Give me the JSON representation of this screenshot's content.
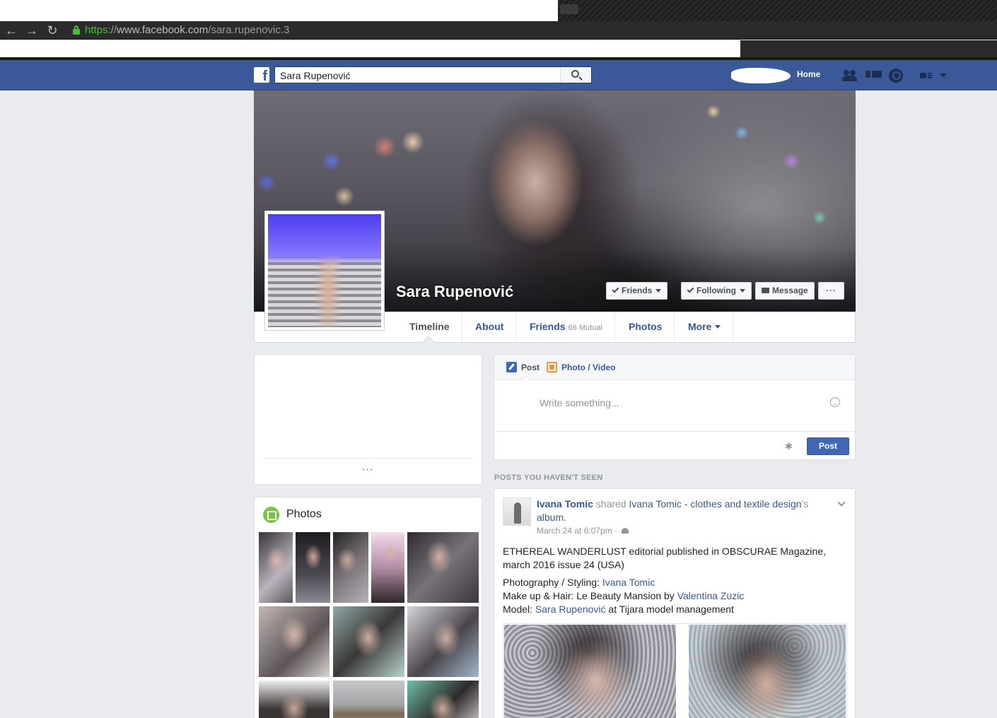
{
  "browser": {
    "url_scheme": "https",
    "url_sep": "://",
    "url_host": "www.facebook.com",
    "url_path": "/sara.rupenovic.3"
  },
  "topbar": {
    "logo": "f",
    "search_value": "Sara Rupenović",
    "home_label": "Home"
  },
  "profile": {
    "name": "Sara Rupenović",
    "buttons": {
      "friends": "Friends",
      "following": "Following",
      "message": "Message",
      "more": "···"
    },
    "tabs": {
      "timeline": "Timeline",
      "about": "About",
      "friends": "Friends",
      "friends_mutual": "66 Mutual",
      "photos": "Photos",
      "more": "More"
    }
  },
  "left": {
    "intro_more": "···",
    "photos_title": "Photos"
  },
  "composer": {
    "tab_post": "Post",
    "tab_photo_video": "Photo / Video",
    "placeholder": "Write something...",
    "post_button": "Post"
  },
  "feed": {
    "section_label": "POSTS YOU HAVEN'T SEEN",
    "post": {
      "actor": "Ivana Tomic",
      "verb": " shared ",
      "target": "Ivana Tomic - clothes and textile design",
      "suffix_1": "'s ",
      "album_word": "album",
      "period": ".",
      "timestamp": "March 24 at 6:07pm · ",
      "line1": "ETHEREAL WANDERLUST editorial published in OBSCURAE Magazine, march 2016 issue 24 (USA)",
      "credit1_label": "Photography / Styling: ",
      "credit1_link": "Ivana Tomic",
      "credit2_label": "Make up & Hair: Le Beauty Mansion by ",
      "credit2_link": "Valentina Zuzic",
      "credit3_label": "Model: ",
      "credit3_link": "Sara Rupenović",
      "credit3_suffix": " at Tijara model management"
    }
  },
  "colors": {
    "facebook_blue": "#3b5998",
    "link_blue": "#365899",
    "button_blue": "#4267b2",
    "page_bg": "#e9ebee",
    "ssl_green": "#4cbb3c"
  }
}
